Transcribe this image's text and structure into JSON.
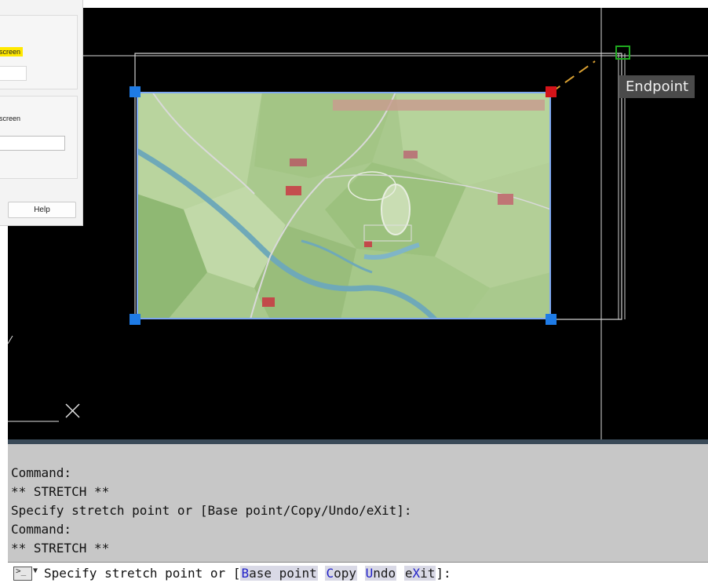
{
  "dialog": {
    "group1_label": "screen",
    "group2_label": "screen",
    "help_button": "Help"
  },
  "canvas": {
    "osnap_tooltip": "Endpoint",
    "background": "#000000",
    "grip_color": "#1e7be6",
    "hot_grip_color": "#d4141a",
    "snap_marker_color": "#1fa81f"
  },
  "command_history": [
    "Command:",
    "** STRETCH **",
    "Specify stretch point or [Base point/Copy/Undo/eXit]:",
    "Command:",
    "** STRETCH **"
  ],
  "command_line": {
    "prompt_before": "Specify stretch point or [",
    "options": [
      {
        "hotkey": "B",
        "rest": "ase point"
      },
      {
        "hotkey": "C",
        "rest": "opy"
      },
      {
        "hotkey": "U",
        "rest": "ndo"
      },
      {
        "pre": "e",
        "hotkey": "X",
        "rest": "it"
      }
    ],
    "prompt_after": "]:"
  }
}
